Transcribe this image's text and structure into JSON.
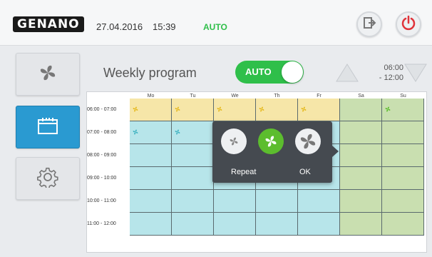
{
  "header": {
    "logo": "GENANO",
    "date": "27.04.2016",
    "time": "15:39",
    "mode": "AUTO"
  },
  "page": {
    "title": "Weekly program",
    "toggle_label": "AUTO",
    "time_range": {
      "start": "06:00",
      "end": "- 12:00"
    }
  },
  "schedule": {
    "days": [
      "Mo",
      "Tu",
      "We",
      "Th",
      "Fr",
      "Sa",
      "Su"
    ],
    "rows": [
      "06:00 - 07:00",
      "07:00 - 08:00",
      "08:00 - 09:00",
      "09:00 - 10:00",
      "10:00 - 11:00",
      "11:00 - 12:00"
    ]
  },
  "popup": {
    "repeat_label": "Repeat",
    "ok_label": "OK"
  },
  "colors": {
    "accent_green": "#2fbf4a",
    "nav_active": "#2a9ad1",
    "power_red": "#e0333a",
    "fan_yellow": "#e5b81b",
    "fan_cyan": "#3eb2c0",
    "fan_green": "#5cbd2e"
  }
}
